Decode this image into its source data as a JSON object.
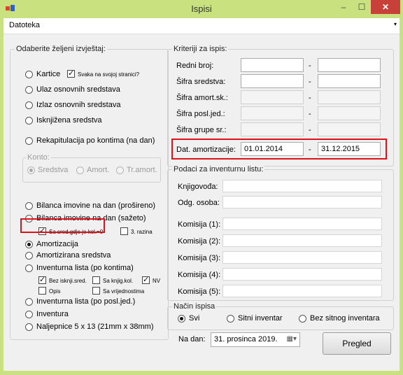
{
  "window": {
    "title": "Ispisi",
    "minimize_glyph": "–",
    "maximize_glyph": "☐",
    "close_glyph": "✕",
    "icon": "app-icon",
    "close_color": "#c7403a",
    "frame_color": "#c9e27f"
  },
  "menu": {
    "label": "Datoteka",
    "arrow": "▾"
  },
  "report_group": {
    "title": "Odaberite željeni izvještaj:",
    "kartice": "Kartice",
    "kartice_check": "Svaka na svojoj stranici?",
    "ulaz": "Ulaz osnovnih sredstava",
    "izlaz": "Izlaz osnovnih sredstava",
    "isknjizena": "Isknjižena sredstva",
    "rekapitulacija": "Rekapitulacija po kontima (na dan)",
    "konto": {
      "title": "Konto:",
      "sredstva": "Sredstva",
      "amort": "Amort.",
      "tramort": "Tr.amort."
    },
    "bilanca_prosireno": "Bilanca imovine na dan (prošireno)",
    "bilanca_sazeto": "Bilanca imovine na dan (sažeto)",
    "sa_sred": "Sa sred.gdje je kol.=0",
    "razina": "3. razina",
    "amortizacija": "Amortizacija",
    "amortizirana": "Amortizirana sredstva",
    "inventurna_kontima": "Inventurna lista (po kontima)",
    "bez_isknji": "Bez isknji.sred.",
    "sa_knjig": "Sa knjig.kol.",
    "nv": "NV",
    "opis": "Opis",
    "sa_vrijednostima": "Sa vrijednostima",
    "inventurna_posl": "Inventurna lista (po posl.jed.)",
    "inventura": "Inventura",
    "naljepnice": "Naljepnice 5 x 13 (21mm x 38mm)"
  },
  "criteria": {
    "title": "Kriteriji za ispis:",
    "redni_broj": "Redni broj:",
    "sifra_sredstva": "Šifra sredstva:",
    "sifra_amort": "Šifra amort.sk.:",
    "sifra_posl": "Šifra posl.jed.:",
    "sifra_grupe": "Šifra grupe sr.:",
    "dat_amort": "Dat. amortizacije:",
    "dat_from": "01.01.2014",
    "dat_to": "31.12.2015",
    "dash": "-"
  },
  "inventory": {
    "title": "Podaci za inventurnu listu:",
    "knjigovodja": "Knjigovođa:",
    "odg_osoba": "Odg. osoba:",
    "komisija1": "Komisija (1):",
    "komisija2": "Komisija (2):",
    "komisija3": "Komisija (3):",
    "komisija4": "Komisija (4):",
    "komisija5": "Komisija (5):"
  },
  "print_mode": {
    "title": "Način ispisa",
    "svi": "Svi",
    "sitni": "Sitni inventar",
    "bez_sitnog": "Bez sitnog inventara"
  },
  "footer": {
    "na_dan": "Na dan:",
    "date": "31. prosinca 2019.",
    "calendar_icon": "▦▾",
    "pregled": "Pregled"
  },
  "highlight_color": "#e0101a"
}
